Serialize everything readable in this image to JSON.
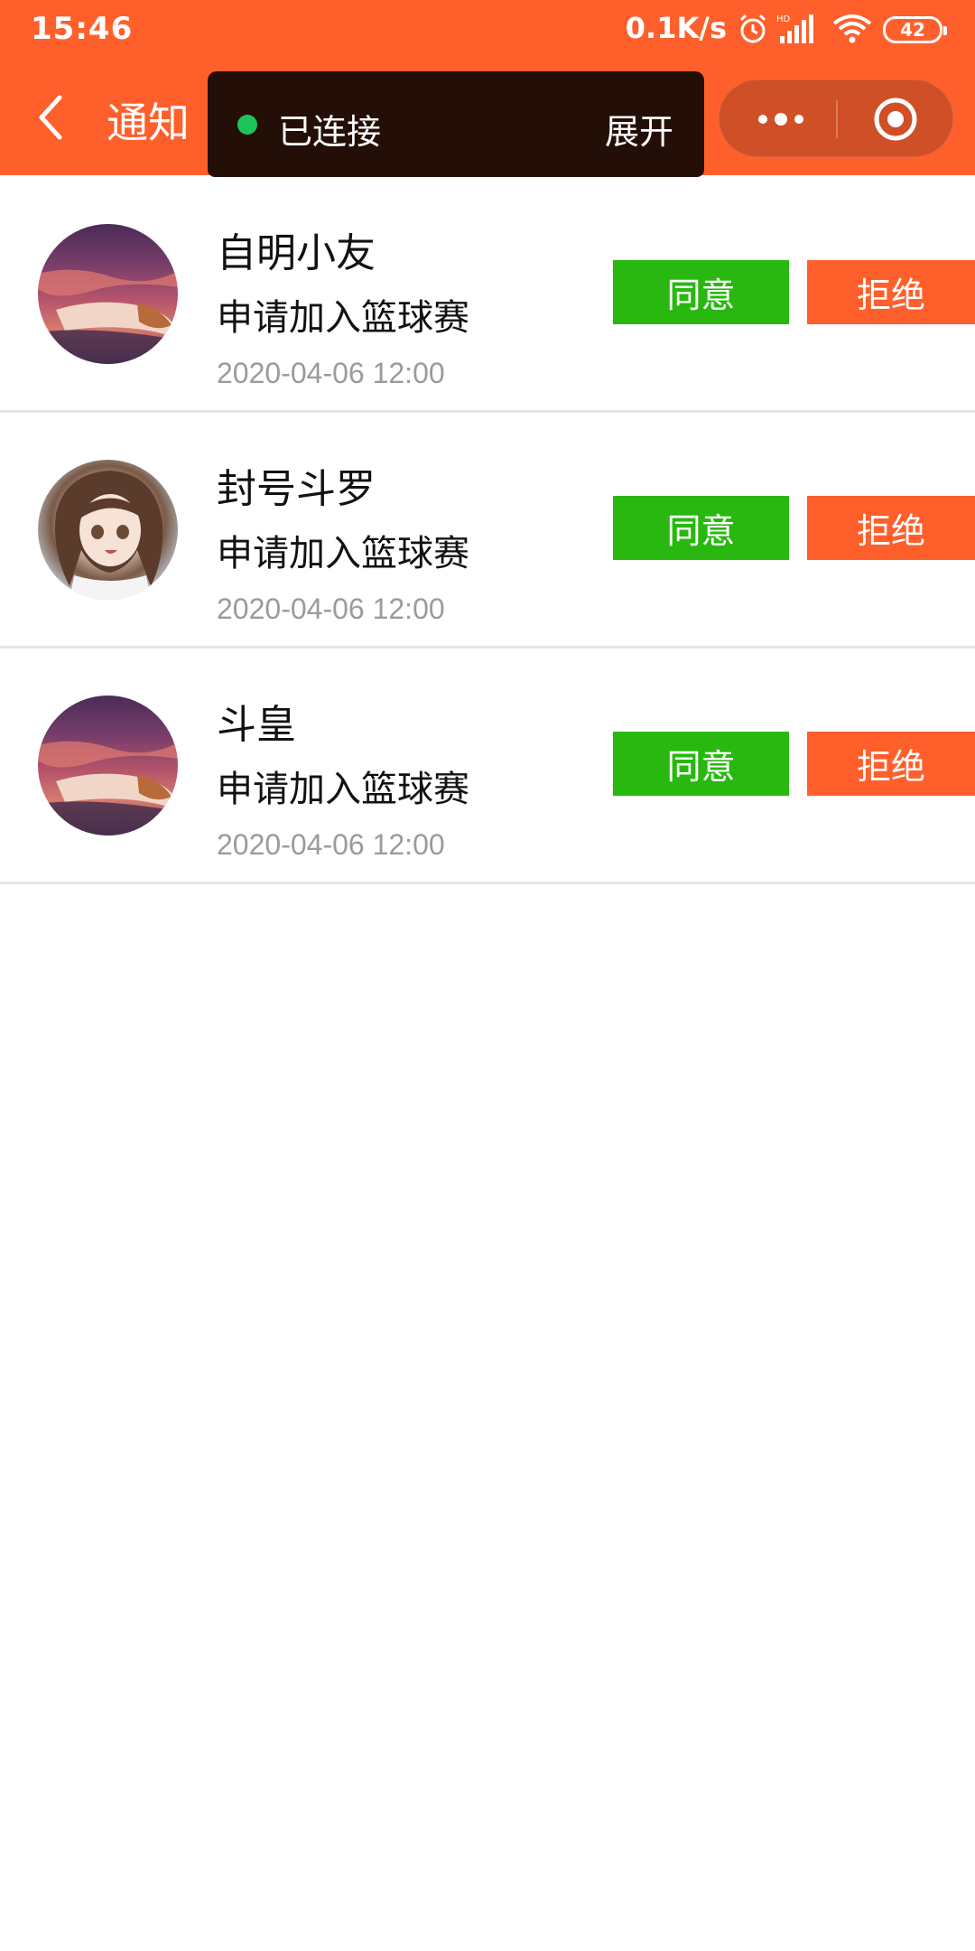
{
  "status_bar": {
    "time": "15:46",
    "network_speed": "0.1K/s",
    "battery": "42",
    "icons": [
      "alarm-icon",
      "signal-icon",
      "wifi-icon",
      "battery-icon"
    ]
  },
  "navbar": {
    "title": "通知",
    "background_color": "#ff5f2b"
  },
  "connection": {
    "status": "已连接",
    "expand_label": "展开",
    "dot_color": "#1dc45b"
  },
  "notifications": [
    {
      "name": "自明小友",
      "message": "申请加入篮球赛",
      "time": "2020-04-06 12:00",
      "agree_label": "同意",
      "reject_label": "拒绝"
    },
    {
      "name": "封号斗罗",
      "message": "申请加入篮球赛",
      "time": "2020-04-06 12:00",
      "agree_label": "同意",
      "reject_label": "拒绝"
    },
    {
      "name": "斗皇",
      "message": "申请加入篮球赛",
      "time": "2020-04-06 12:00",
      "agree_label": "同意",
      "reject_label": "拒绝"
    }
  ],
  "colors": {
    "accent": "#ff5f2b",
    "agree": "#28b80f",
    "reject": "#ff5f2b",
    "time_text": "#9b9b9b"
  }
}
